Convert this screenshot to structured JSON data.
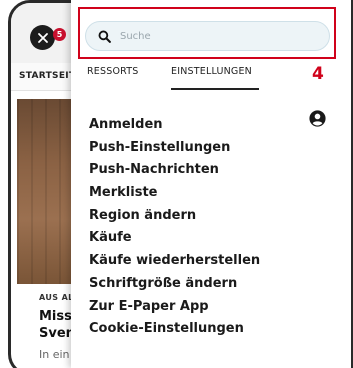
{
  "background_page": {
    "tab_label": "STARTSEITE",
    "kicker": "AUS AL",
    "headline_line1": "Missl",
    "headline_line2": "Sven",
    "teaser": "In ein"
  },
  "header": {
    "close_button": {
      "icon": "close-icon"
    },
    "badge_count": "5"
  },
  "search": {
    "placeholder": "Suche",
    "value": "",
    "icon": "search-icon"
  },
  "annotation": {
    "step_number": "4",
    "highlight_color": "#d0021b"
  },
  "menu": {
    "tabs": [
      {
        "label": "RESSORTS",
        "active": false
      },
      {
        "label": "EINSTELLUNGEN",
        "active": true
      }
    ],
    "account_icon": "account-circle-icon",
    "items": [
      {
        "label": "Anmelden"
      },
      {
        "label": "Push-Einstellungen"
      },
      {
        "label": "Push-Nachrichten"
      },
      {
        "label": "Merkliste"
      },
      {
        "label": "Region ändern"
      },
      {
        "label": "Käufe"
      },
      {
        "label": "Käufe wiederherstellen"
      },
      {
        "label": "Schriftgröße ändern"
      },
      {
        "label": "Zur E-Paper App"
      },
      {
        "label": "Cookie-Einstellungen"
      }
    ]
  },
  "colors": {
    "accent_red": "#d0021b",
    "badge_red": "#c8102e",
    "search_bg": "#edf4f7",
    "text_dark": "#1a1a1a"
  }
}
